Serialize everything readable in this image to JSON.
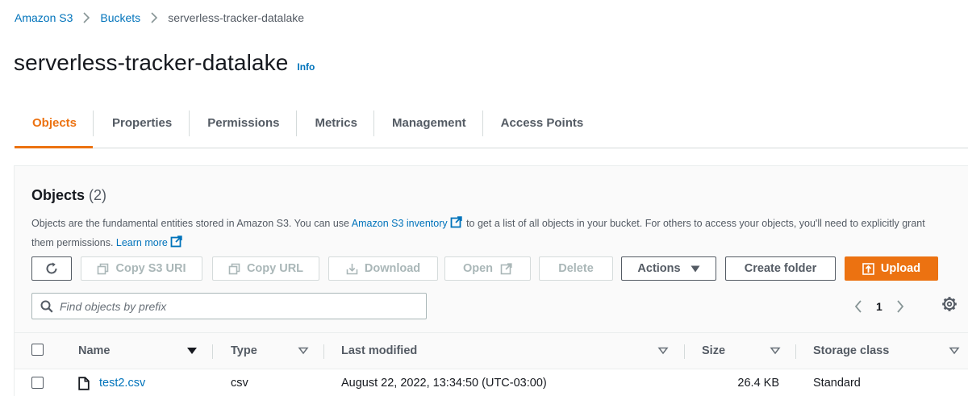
{
  "breadcrumb": {
    "items": [
      "Amazon S3",
      "Buckets"
    ],
    "current": "serverless-tracker-datalake"
  },
  "page": {
    "title": "serverless-tracker-datalake",
    "info_link": "Info"
  },
  "tabs": [
    {
      "label": "Objects",
      "active": true
    },
    {
      "label": "Properties",
      "active": false
    },
    {
      "label": "Permissions",
      "active": false
    },
    {
      "label": "Metrics",
      "active": false
    },
    {
      "label": "Management",
      "active": false
    },
    {
      "label": "Access Points",
      "active": false
    }
  ],
  "objects_panel": {
    "title": "Objects",
    "count": "(2)",
    "description": {
      "part1": "Objects are the fundamental entities stored in Amazon S3. You can use ",
      "link1": "Amazon S3 inventory",
      "part2": " to get a list of all objects in your bucket. For others to access your objects, you'll need to explicitly grant them permissions. ",
      "link2": "Learn more"
    },
    "toolbar": {
      "refresh_icon": "refresh-icon",
      "copy_s3_uri": "Copy S3 URI",
      "copy_url": "Copy URL",
      "download": "Download",
      "open": "Open",
      "delete": "Delete",
      "actions": "Actions",
      "create_folder": "Create folder",
      "upload": "Upload"
    },
    "search": {
      "placeholder": "Find objects by prefix",
      "value": ""
    },
    "pagination": {
      "current_page": "1"
    },
    "table": {
      "columns": [
        "Name",
        "Type",
        "Last modified",
        "Size",
        "Storage class"
      ],
      "rows": [
        {
          "name": "test2.csv",
          "type": "csv",
          "last_modified": "August 22, 2022, 13:34:50 (UTC-03:00)",
          "size": "26.4 KB",
          "storage_class": "Standard"
        }
      ]
    }
  },
  "colors": {
    "accent": "#ec7211",
    "link": "#0073bb",
    "text": "#16191f",
    "muted": "#545b64",
    "disabled": "#aab7b8"
  }
}
